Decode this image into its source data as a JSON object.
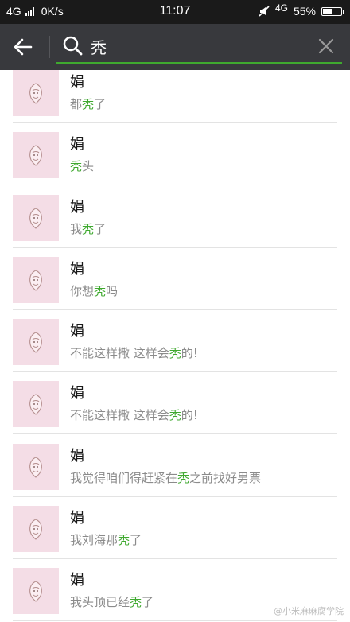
{
  "status_bar": {
    "network_left": "4G",
    "speed": "0K/s",
    "time": "11:07",
    "network_right": "4G",
    "battery": "55%",
    "battery_level": 0.55
  },
  "search": {
    "query": "秃",
    "underline_color": "#3fa92f"
  },
  "results": [
    {
      "name": "娟",
      "pre": "都",
      "hl": "秃",
      "post": "了"
    },
    {
      "name": "娟",
      "pre": "",
      "hl": "秃",
      "post": "头"
    },
    {
      "name": "娟",
      "pre": "我",
      "hl": "秃",
      "post": "了"
    },
    {
      "name": "娟",
      "pre": "你想",
      "hl": "秃",
      "post": "吗"
    },
    {
      "name": "娟",
      "pre": "不能这样撒 这样会",
      "hl": "秃",
      "post": "的!"
    },
    {
      "name": "娟",
      "pre": "不能这样撒 这样会",
      "hl": "秃",
      "post": "的!"
    },
    {
      "name": "娟",
      "pre": "我觉得咱们得赶紧在",
      "hl": "秃",
      "post": "之前找好男票"
    },
    {
      "name": "娟",
      "pre": "我刘海那",
      "hl": "秃",
      "post": "了"
    },
    {
      "name": "娟",
      "pre": "我头顶已经",
      "hl": "秃",
      "post": "了"
    }
  ],
  "watermark": "@小米麻麻腐学院",
  "colors": {
    "highlight": "#3fa92f",
    "header": "#38393d",
    "avatar_bg": "#f4dde6"
  }
}
